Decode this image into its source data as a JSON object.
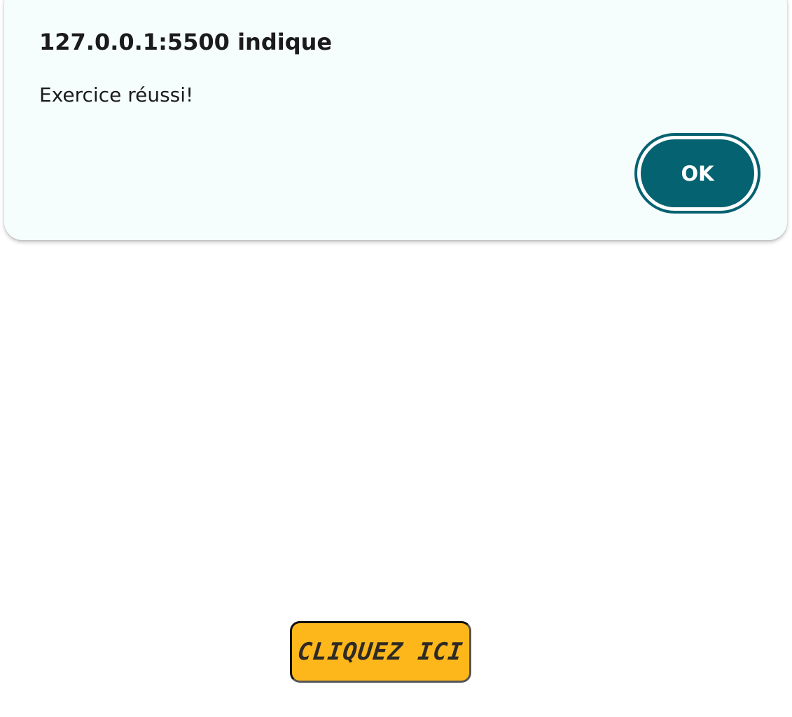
{
  "dialog": {
    "title": "127.0.0.1:5500 indique",
    "message": "Exercice réussi!",
    "ok_label": "OK"
  },
  "page": {
    "button_label": "CLIQUEZ ICI"
  },
  "colors": {
    "dialog_background": "#f6fdfd",
    "ok_button": "#056270",
    "page_button": "#fdb71b",
    "text": "#1b1b1b"
  }
}
